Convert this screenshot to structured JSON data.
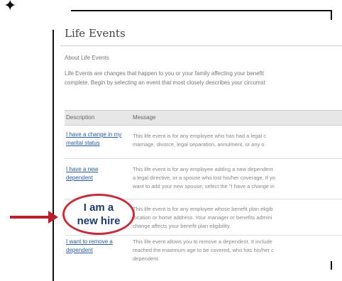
{
  "page": {
    "title": "Life Events",
    "section_heading": "About Life Events",
    "intro_lines": [
      "Life Events are changes that happen to you or your family affecting your benefit",
      "complete. Begin by selecting an event that most closely describes your circumst"
    ]
  },
  "table": {
    "headers": [
      "Description",
      "Message"
    ],
    "rows": [
      {
        "description": "I have a change in my marital status",
        "message_lines": [
          "This life event is for any employee who has had a legal c",
          "marriage, divorce, legal separation, annulment, or any o"
        ]
      },
      {
        "description": "I have a new dependent",
        "message_lines": [
          "This life event is for any employee adding a new dependent",
          "a legal directive, or a spouse who lost his/her coverage. If yo",
          "want to add your new spouse, select the \"I have a change in"
        ]
      },
      {
        "description": "",
        "message_lines": [
          "This life event is for any employee whose benefit plan eligib",
          "location or home address. Your manager or benefits admini",
          "change affects your benefit plan eligibility."
        ]
      },
      {
        "description": "I want to remove a dependent",
        "message_lines": [
          "This life event allows you to remove a dependent. It include",
          "reached the maximum age to be covered, who has his/her c",
          "dependent."
        ]
      }
    ]
  },
  "callout": {
    "text_line1": "I am a",
    "text_line2": "new hire",
    "circle_color": "#c62c3a",
    "arrow_color": "#b8202d",
    "text_color": "#1f3a6c"
  },
  "decoration": {
    "sparkle": "✦"
  }
}
